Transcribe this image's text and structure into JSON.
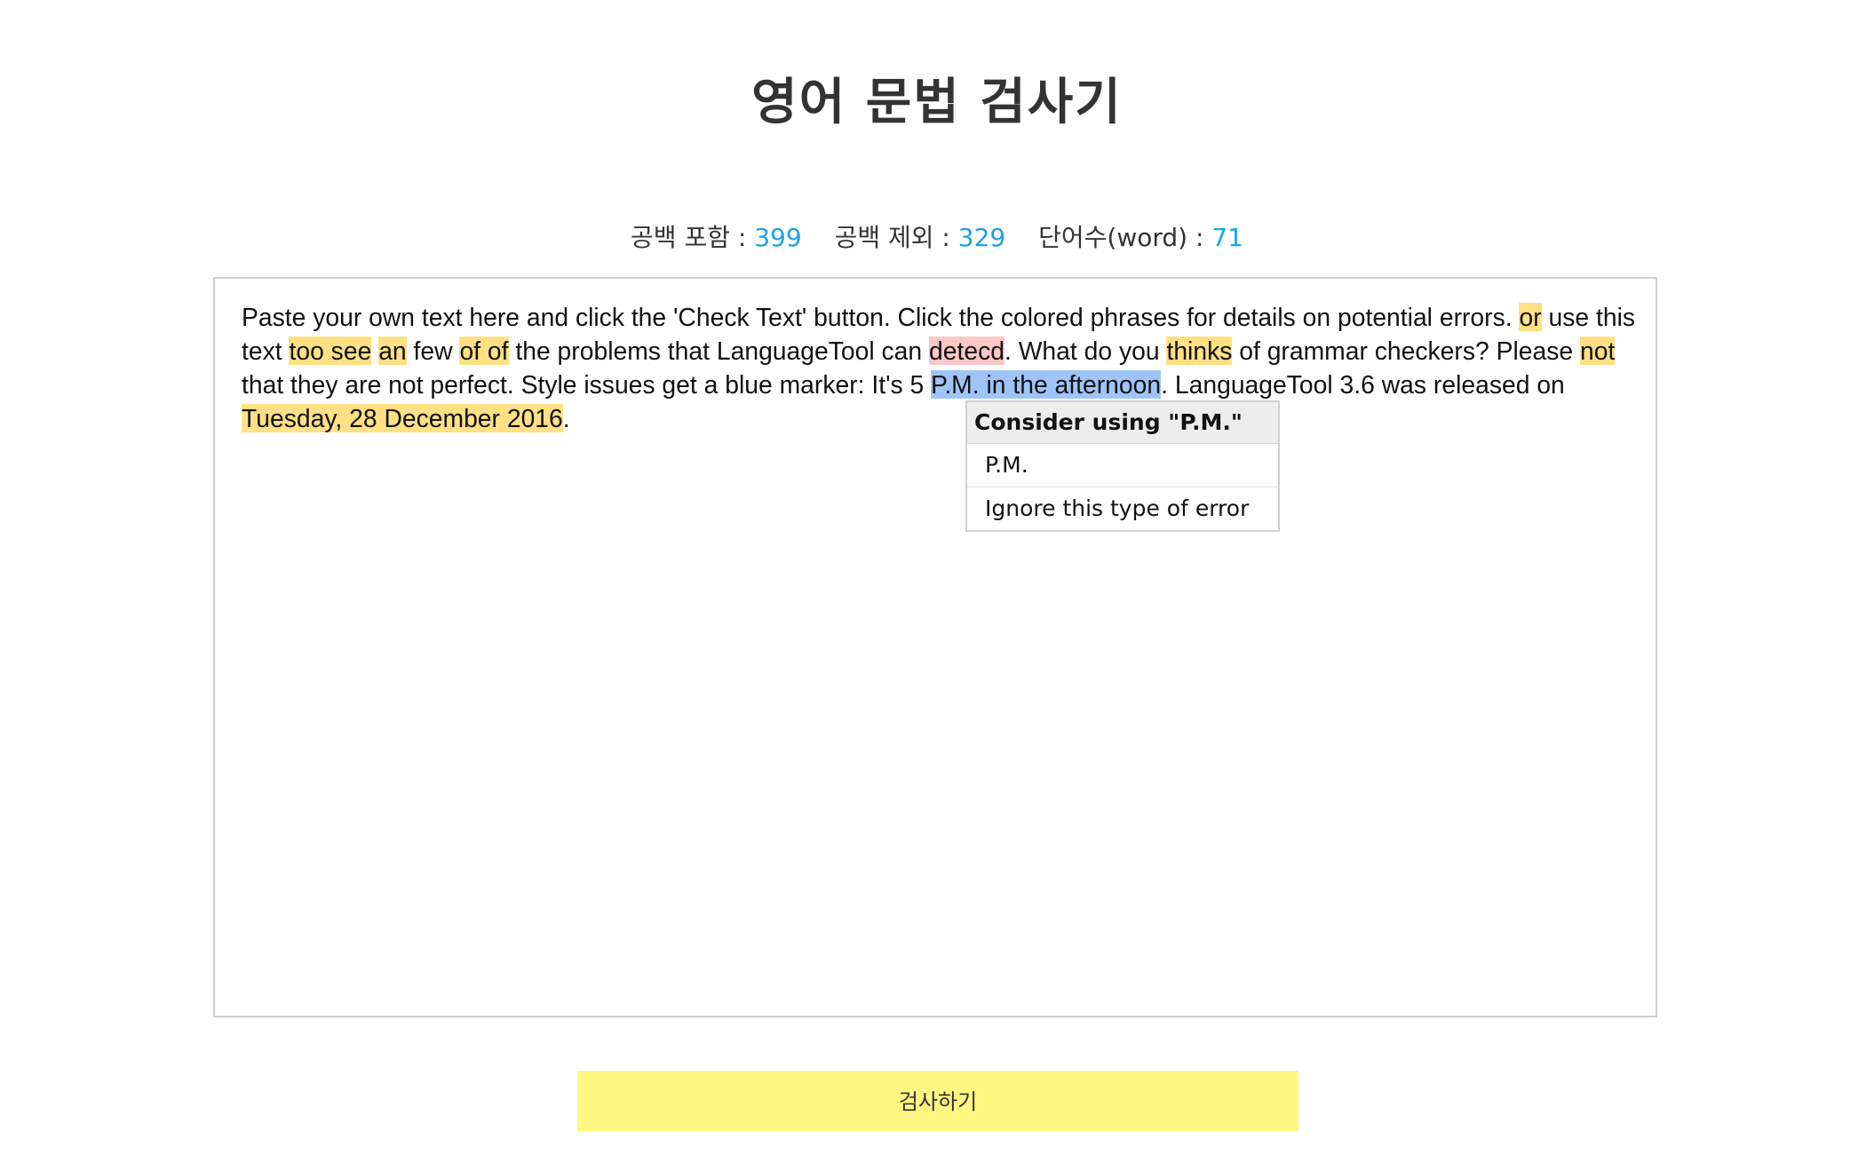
{
  "title": "영어 문법 검사기",
  "stats": {
    "with_spaces_label": "공백 포함 :",
    "with_spaces_value": "399",
    "without_spaces_label": "공백 제외 :",
    "without_spaces_value": "329",
    "words_label": "단어수(word) :",
    "words_value": "71"
  },
  "editor": {
    "segments": [
      {
        "text": "Paste your own text here and click the 'Check Text' button. Click the colored phrases for details on potential errors. ",
        "mark": ""
      },
      {
        "text": "or",
        "mark": "yellow"
      },
      {
        "text": " use this text ",
        "mark": ""
      },
      {
        "text": "too see",
        "mark": "yellow"
      },
      {
        "text": " ",
        "mark": ""
      },
      {
        "text": "an",
        "mark": "yellow"
      },
      {
        "text": " few ",
        "mark": ""
      },
      {
        "text": "of of",
        "mark": "yellow"
      },
      {
        "text": " the problems that LanguageTool can ",
        "mark": ""
      },
      {
        "text": "detecd",
        "mark": "red"
      },
      {
        "text": ". What do you ",
        "mark": ""
      },
      {
        "text": "thinks",
        "mark": "yellow"
      },
      {
        "text": " of grammar checkers? Please ",
        "mark": ""
      },
      {
        "text": "not",
        "mark": "yellow"
      },
      {
        "text": " that they are not perfect. Style issues get a blue marker: It's 5 ",
        "mark": ""
      },
      {
        "text": "P.M. in the afternoon",
        "mark": "blue"
      },
      {
        "text": ". LanguageTool 3.6 was released on ",
        "mark": ""
      },
      {
        "text": "Tuesday, 28 December 2016",
        "mark": "yellow"
      },
      {
        "text": ".",
        "mark": ""
      }
    ]
  },
  "popup": {
    "header": "Consider using \"P.M.\"",
    "suggestion": "P.M.",
    "ignore": "Ignore this type of error"
  },
  "button": {
    "label": "검사하기"
  },
  "colors": {
    "accent_blue": "#1aa3e8",
    "highlight_yellow": "#ffe084",
    "highlight_red": "#fcc7c7",
    "highlight_blue": "#9fc5f8",
    "button_yellow": "#fff782"
  }
}
